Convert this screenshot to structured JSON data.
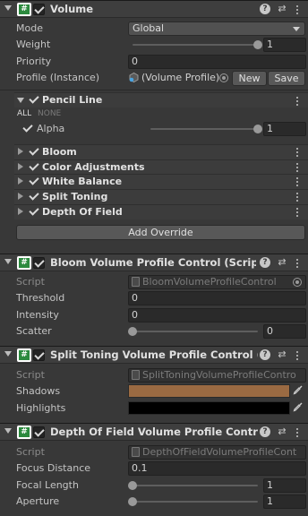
{
  "volume": {
    "title": "Volume",
    "mode_label": "Mode",
    "mode_value": "Global",
    "weight_label": "Weight",
    "weight_value": "1",
    "weight_fraction": 1.0,
    "priority_label": "Priority",
    "priority_value": "0",
    "profile_label": "Profile (Instance)",
    "profile_value": "(Volume Profile)",
    "new_button": "New",
    "save_button": "Save"
  },
  "pencil_line": {
    "name": "Pencil Line",
    "all_label": "ALL",
    "none_label": "NONE",
    "alpha_label": "Alpha",
    "alpha_value": "1",
    "alpha_fraction": 1.0
  },
  "overrides": [
    {
      "name": "Bloom"
    },
    {
      "name": "Color Adjustments"
    },
    {
      "name": "White Balance"
    },
    {
      "name": "Split Toning"
    },
    {
      "name": "Depth Of Field"
    }
  ],
  "add_override_button": "Add Override",
  "bloom_control": {
    "title": "Bloom Volume Profile Control (Script)",
    "script_label": "Script",
    "script_value": "BloomVolumeProfileControl",
    "threshold_label": "Threshold",
    "threshold_value": "0",
    "intensity_label": "Intensity",
    "intensity_value": "0",
    "scatter_label": "Scatter",
    "scatter_value": "0",
    "scatter_fraction": 0.0
  },
  "split_toning_control": {
    "title": "Split Toning Volume Profile Control (Script)",
    "script_label": "Script",
    "script_value": "SplitToningVolumeProfileContro",
    "shadows_label": "Shadows",
    "shadows_color": "#9a6a42",
    "highlights_label": "Highlights",
    "highlights_color": "#000000"
  },
  "dof_control": {
    "title": "Depth Of Field Volume Profile Control (Scri",
    "script_label": "Script",
    "script_value": "DepthOfFieldVolumeProfileCont",
    "focus_distance_label": "Focus Distance",
    "focus_distance_value": "0.1",
    "focal_length_label": "Focal Length",
    "focal_length_value": "1",
    "focal_length_fraction": 0.0,
    "aperture_label": "Aperture",
    "aperture_value": "1",
    "aperture_fraction": 0.0
  },
  "colors": {
    "panel_bg": "#383838",
    "header_bg": "#3e3e3e",
    "script_icon_green": "#2c8a3e"
  },
  "icons": {
    "help": "help-icon",
    "presets": "presets-icon",
    "kebab": "kebab-menu-icon",
    "eyedropper": "eyedropper-icon"
  }
}
